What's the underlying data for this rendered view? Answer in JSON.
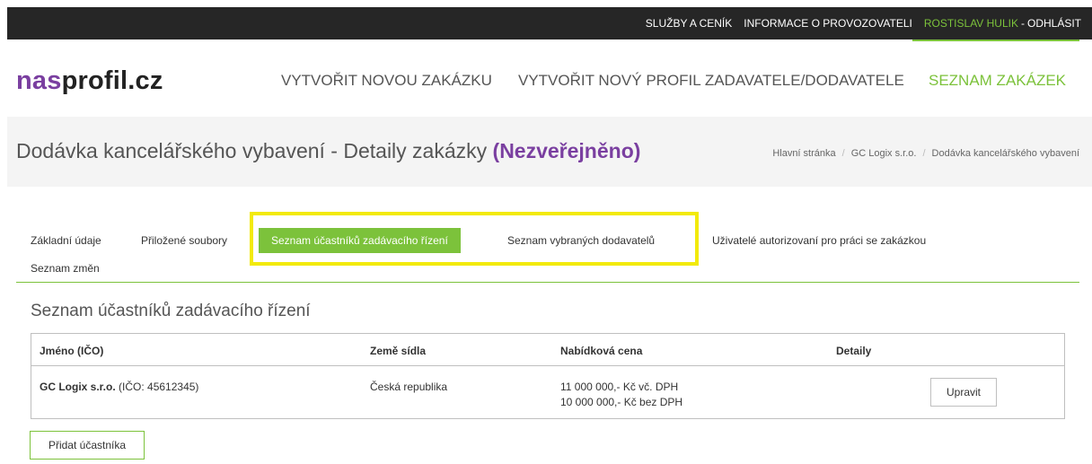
{
  "topbar": {
    "services": "SLUŽBY A CENÍK",
    "operator_info": "INFORMACE O PROVOZOVATELI",
    "user": "ROSTISLAV HULIK",
    "separator": "-",
    "logout": "ODHLÁSIT"
  },
  "logo": {
    "part1": "nas",
    "part2": "profil.cz"
  },
  "mainnav": {
    "create_order": "VYTVOŘIT NOVOU ZAKÁZKU",
    "create_profile": "VYTVOŘIT NOVÝ PROFIL ZADAVATELE/DODAVATELE",
    "order_list": "SEZNAM ZAKÁZEK"
  },
  "page": {
    "title": "Dodávka kancelářského vybavení - Detaily zakázky",
    "status": "(Nezveřejněno)"
  },
  "breadcrumb": [
    "Hlavní stránka",
    "GC Logix s.r.o.",
    "Dodávka kancelářského vybavení"
  ],
  "tabs": [
    "Základní údaje",
    "Přiložené soubory",
    "Seznam účastníků zadávacího řízení",
    "Seznam vybraných dodavatelů",
    "Uživatelé autorizovaní pro práci se zakázkou",
    "Seznam změn"
  ],
  "section": {
    "title": "Seznam účastníků zadávacího řízení"
  },
  "table": {
    "headers": [
      "Jméno (IČO)",
      "Země sídla",
      "Nabídková cena",
      "Detaily"
    ],
    "rows": [
      {
        "name": "GC Logix s.r.o.",
        "ico": "(IČO: 45612345)",
        "country": "Česká republika",
        "price_with_vat": "11 000 000,- Kč vč. DPH",
        "price_without_vat": "10 000 000,- Kč bez DPH",
        "edit_label": "Upravit"
      }
    ]
  },
  "add_participant_label": "Přidat účastníka",
  "colors": {
    "accent": "#7cc23b",
    "brand_purple": "#7a3fa0",
    "highlight": "#f2ea0a",
    "topbar": "#262626"
  }
}
